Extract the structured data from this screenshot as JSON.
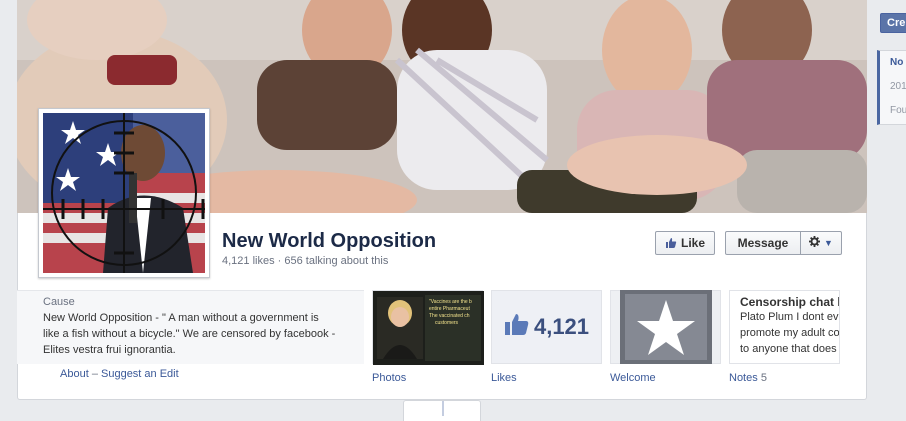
{
  "header": {
    "page_name": "New World Opposition",
    "stats": "4,121 likes · 656 talking about this"
  },
  "actions": {
    "like_label": "Like",
    "message_label": "Message",
    "gear_caret": "▼"
  },
  "about": {
    "category": "Cause",
    "description": "New World Opposition - \" A man without a government is like a fish without a bicycle.\" We are censored by facebook - Elites vestra frui ignorantia.",
    "about_link": "About",
    "separator": "–",
    "suggest_edit_link": "Suggest an Edit"
  },
  "apps": [
    {
      "label": "Photos",
      "count": ""
    },
    {
      "label": "Likes",
      "count": "",
      "value": "4,121"
    },
    {
      "label": "Welcome",
      "count": ""
    },
    {
      "label": "Notes",
      "count": "5"
    }
  ],
  "photo_tile": {
    "text_lines": [
      "\"Vaccines are the b",
      "entire Pharmaceut",
      "The vaccinated ch",
      "customers"
    ]
  },
  "notes_tile": {
    "title": "Censorship chat lo",
    "lines": [
      "Plato Plum I dont eve",
      "promote my adult co",
      "to anyone that does"
    ]
  },
  "right_rail": {
    "create_label": "Cre",
    "line1": "No",
    "line2": "201",
    "line3": "Fou"
  },
  "colors": {
    "brand": "#3b5998",
    "page_bg": "#e9ebee"
  }
}
